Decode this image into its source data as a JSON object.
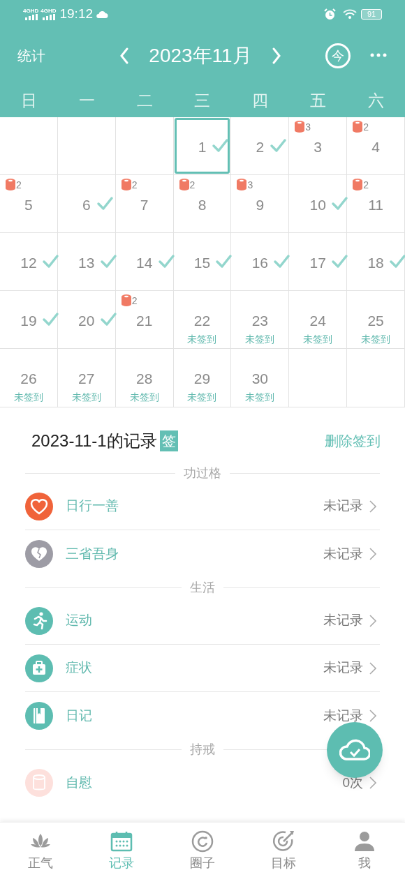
{
  "status_bar": {
    "networks": [
      "4GHD",
      "4GHD"
    ],
    "time": "19:12",
    "battery": "91"
  },
  "header": {
    "left": "统计",
    "title": "2023年11月",
    "today": "今"
  },
  "weekdays": [
    "日",
    "一",
    "二",
    "三",
    "四",
    "五",
    "六"
  ],
  "calendar": [
    {
      "kind": "empty",
      "selected": false
    },
    {
      "kind": "empty",
      "selected": false
    },
    {
      "kind": "empty",
      "selected": false
    },
    {
      "kind": "checked",
      "day": "1",
      "selected": true
    },
    {
      "kind": "checked",
      "day": "2",
      "selected": false
    },
    {
      "kind": "badge",
      "day": "3",
      "count": "3",
      "selected": false
    },
    {
      "kind": "badge",
      "day": "4",
      "count": "2",
      "selected": false
    },
    {
      "kind": "badge",
      "day": "5",
      "count": "2",
      "selected": false
    },
    {
      "kind": "checked",
      "day": "6",
      "selected": false
    },
    {
      "kind": "badge",
      "day": "7",
      "count": "2",
      "selected": false
    },
    {
      "kind": "badge",
      "day": "8",
      "count": "2",
      "selected": false
    },
    {
      "kind": "badge",
      "day": "9",
      "count": "3",
      "selected": false
    },
    {
      "kind": "checked",
      "day": "10",
      "selected": false
    },
    {
      "kind": "badge",
      "day": "11",
      "count": "2",
      "selected": false
    },
    {
      "kind": "checked",
      "day": "12",
      "selected": false
    },
    {
      "kind": "checked",
      "day": "13",
      "selected": false
    },
    {
      "kind": "checked",
      "day": "14",
      "selected": false
    },
    {
      "kind": "checked",
      "day": "15",
      "selected": false
    },
    {
      "kind": "checked",
      "day": "16",
      "selected": false
    },
    {
      "kind": "checked",
      "day": "17",
      "selected": false
    },
    {
      "kind": "checked",
      "day": "18",
      "selected": false
    },
    {
      "kind": "checked",
      "day": "19",
      "selected": false
    },
    {
      "kind": "checked",
      "day": "20",
      "selected": false
    },
    {
      "kind": "badge",
      "day": "21",
      "count": "2",
      "selected": false
    },
    {
      "kind": "unsigned",
      "day": "22",
      "note": "未签到",
      "selected": false
    },
    {
      "kind": "unsigned",
      "day": "23",
      "note": "未签到",
      "selected": false
    },
    {
      "kind": "unsigned",
      "day": "24",
      "note": "未签到",
      "selected": false
    },
    {
      "kind": "unsigned",
      "day": "25",
      "note": "未签到",
      "selected": false
    },
    {
      "kind": "unsigned",
      "day": "26",
      "note": "未签到",
      "selected": false
    },
    {
      "kind": "unsigned",
      "day": "27",
      "note": "未签到",
      "selected": false
    },
    {
      "kind": "unsigned",
      "day": "28",
      "note": "未签到",
      "selected": false
    },
    {
      "kind": "unsigned",
      "day": "29",
      "note": "未签到",
      "selected": false
    },
    {
      "kind": "unsigned",
      "day": "30",
      "note": "未签到",
      "selected": false
    },
    {
      "kind": "empty",
      "selected": false
    },
    {
      "kind": "empty",
      "selected": false
    }
  ],
  "records": {
    "title": "2023-11-1的记录",
    "tag": "签",
    "action": "删除签到",
    "sections": [
      {
        "label": "功过格",
        "items": [
          {
            "kind": "heart",
            "color": "#f0633a",
            "name": "日行一善",
            "value": "未记录"
          },
          {
            "kind": "broken-heart",
            "color": "#9d9ca5",
            "name": "三省吾身",
            "value": "未记录"
          }
        ]
      },
      {
        "label": "生活",
        "items": [
          {
            "kind": "runner",
            "color": "#5dbdb1",
            "name": "运动",
            "value": "未记录"
          },
          {
            "kind": "medkit",
            "color": "#5dbdb1",
            "name": "症状",
            "value": "未记录"
          },
          {
            "kind": "book",
            "color": "#5dbdb1",
            "name": "日记",
            "value": "未记录"
          }
        ]
      },
      {
        "label": "持戒",
        "items": [
          {
            "kind": "roll",
            "color": "#fde0dc",
            "name": "自慰",
            "value": "0次"
          }
        ]
      }
    ]
  },
  "tabs": [
    {
      "kind": "lotus",
      "label": "正气",
      "selected": false
    },
    {
      "kind": "calendar",
      "label": "记录",
      "selected": true
    },
    {
      "kind": "ring",
      "label": "圈子",
      "selected": false
    },
    {
      "kind": "target",
      "label": "目标",
      "selected": false
    },
    {
      "kind": "person",
      "label": "我",
      "selected": false
    }
  ]
}
